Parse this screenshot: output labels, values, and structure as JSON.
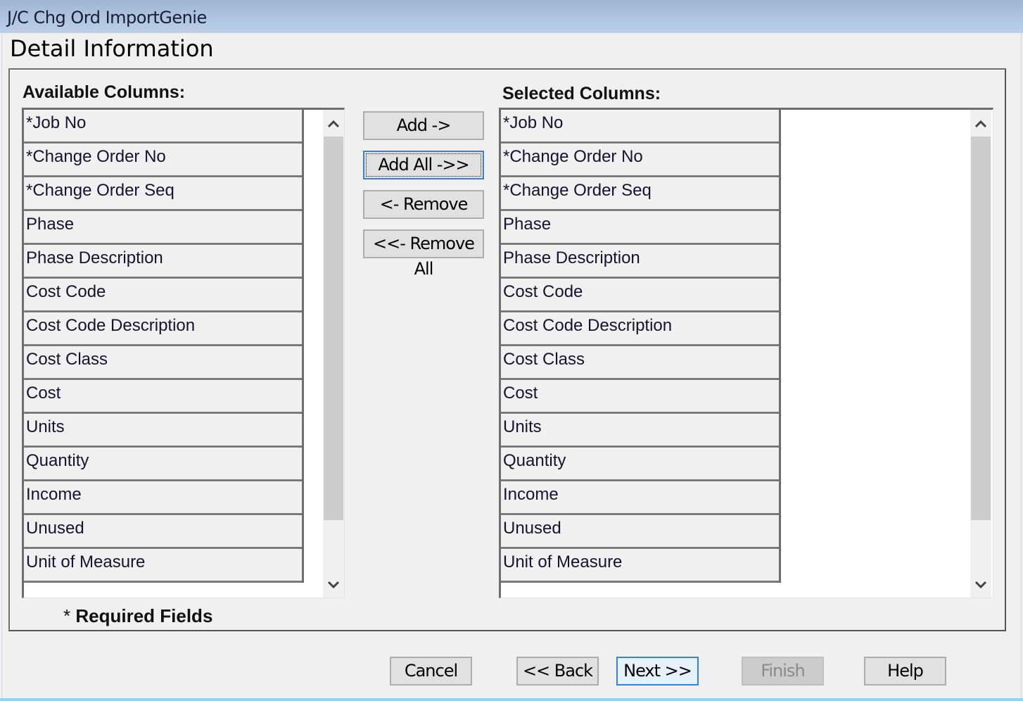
{
  "window": {
    "title": "J/C Chg Ord ImportGenie"
  },
  "page": {
    "heading": "Detail Information"
  },
  "available": {
    "label": "Available Columns:",
    "items": [
      "*Job No",
      "*Change Order No",
      "*Change Order Seq",
      "Phase",
      "Phase Description",
      "Cost Code",
      "Cost Code Description",
      "Cost Class",
      "Cost",
      "Units",
      "Quantity",
      "Income",
      "Unused",
      "Unit of Measure"
    ]
  },
  "selected": {
    "label": "Selected Columns:",
    "items": [
      "*Job No",
      "*Change Order No",
      "*Change Order Seq",
      "Phase",
      "Phase Description",
      "Cost Code",
      "Cost Code Description",
      "Cost Class",
      "Cost",
      "Units",
      "Quantity",
      "Income",
      "Unused",
      "Unit of Measure"
    ]
  },
  "transfer_buttons": {
    "add": "Add ->",
    "add_all": "Add All ->>",
    "remove": "<- Remove",
    "remove_all": "<<- Remove All"
  },
  "note": {
    "star": "*",
    "text": "Required Fields"
  },
  "footer_buttons": {
    "cancel": "Cancel",
    "back": "<< Back",
    "next": "Next >>",
    "finish": "Finish",
    "help": "Help"
  },
  "states": {
    "focused_button": "add_all",
    "default_button": "next",
    "disabled_buttons": [
      "finish"
    ]
  },
  "icons": {
    "scroll_up": "chevron-up-icon",
    "scroll_down": "chevron-down-icon"
  }
}
